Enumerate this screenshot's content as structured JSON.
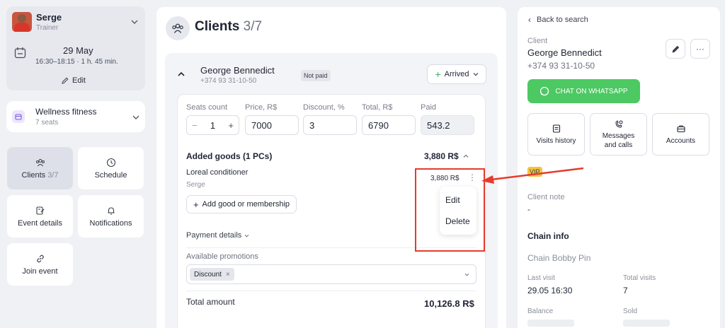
{
  "trainer": {
    "name": "Serge",
    "role": "Trainer"
  },
  "event": {
    "date": "29 May",
    "time": "16:30–18:15 · 1 h. 45 min.",
    "edit_label": "Edit"
  },
  "service": {
    "name": "Wellness fitness",
    "seats": "7 seats"
  },
  "nav": {
    "clients_label": "Clients",
    "clients_count": "3/7",
    "schedule_label": "Schedule",
    "event_details_label": "Event details",
    "notifications_label": "Notifications",
    "join_event_label": "Join event"
  },
  "main": {
    "title": "Clients",
    "title_count": "3/7",
    "client": {
      "name": "George Bennedict",
      "phone": "+374 93 31-10-50",
      "payment_status": "Not paid",
      "arrival_status": "Arrived"
    },
    "fields": {
      "seats_label": "Seats count",
      "seats_value": "1",
      "price_label": "Price, R$",
      "price_value": "7000",
      "discount_label": "Discount, %",
      "discount_value": "3",
      "total_label": "Total, R$",
      "total_value": "6790",
      "paid_label": "Paid",
      "paid_value": "543.2"
    },
    "goods": {
      "header": "Added goods (1 PCs)",
      "header_total": "3,880 R$",
      "item_name": "Loreal conditioner",
      "item_seller": "Serge",
      "item_price": "3,880 R$",
      "add_label": "Add good or membership"
    },
    "context_menu": {
      "edit": "Edit",
      "delete": "Delete"
    },
    "payment_details_label": "Payment details",
    "promotions_label": "Available promotions",
    "promotion_tag": "Discount",
    "total_amount_label": "Total amount",
    "total_amount_value": "10,126.8 R$"
  },
  "right": {
    "back_label": "Back to search",
    "client_label": "Client",
    "client_name": "George Bennedict",
    "client_phone": "+374 93 31-10-50",
    "whatsapp_label": "CHAT ON WHATSAPP",
    "actions": {
      "visits": "Visits history",
      "messages_l1": "Messages",
      "messages_l2": "and calls",
      "accounts": "Accounts"
    },
    "vip_badge": "VIP",
    "note_label": "Client note",
    "note_value": "-",
    "chain_header": "Chain info",
    "chain_name": "Chain Bobby Pin",
    "last_visit_label": "Last visit",
    "last_visit_value": "29.05 16:30",
    "total_visits_label": "Total visits",
    "total_visits_value": "7",
    "balance_label": "Balance",
    "sold_label": "Sold"
  },
  "colors": {
    "whatsapp": "#4cc962",
    "annotation": "#e53b2c",
    "vip": "#f2c53d",
    "background": "#f0f1f5"
  }
}
